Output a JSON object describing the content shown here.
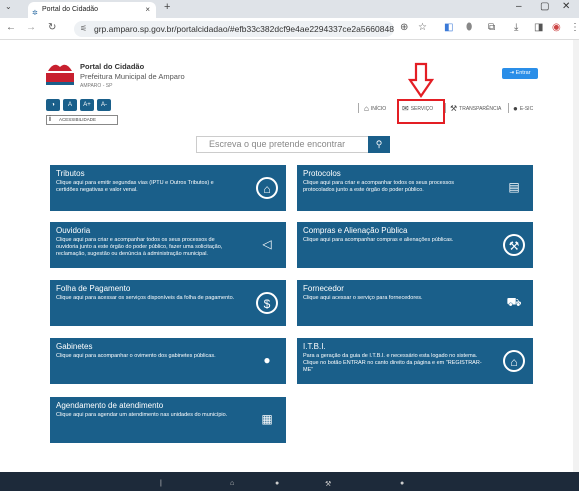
{
  "browser": {
    "tab_title": "Portal do Cidadão",
    "tab_close": "×",
    "new_tab": "+",
    "url": "grp.amparo.sp.gov.br/portalcidadao/#efb33c382dcf9e4ae2294337ce2a5660848a422c1230..."
  },
  "header": {
    "site_name": "Portal do Cidadão",
    "site_sub": "Prefeitura Municipal de Amparo",
    "site_city": "AMPARO - SP",
    "acc_buttons": [
      "◑",
      "A",
      "A+",
      "A-"
    ],
    "acc_label": "ACESSIBILIDADE",
    "acc_label_icon": "i",
    "login_label": "Entrar",
    "nav": {
      "inicio": "INÍCIO",
      "servico": "SERVIÇO",
      "transparencia": "TRANSPARÊNCIA",
      "esic": "E-SIC"
    }
  },
  "search": {
    "placeholder": "Escreva o que pretende encontrar"
  },
  "cards": [
    {
      "title": "Tributos",
      "desc": "Clique aqui para emitir segundas vias (IPTU e Outros Tributos) e certidões negativas e valor venal.",
      "icon": "bank-icon"
    },
    {
      "title": "Protocolos",
      "desc": "Clique aqui para criar e acompanhar todos os seus processos protocolados junto a este órgão do poder público.",
      "icon": "document-icon"
    },
    {
      "title": "Ouvidoria",
      "desc": "Clique aqui para criar e acompanhar todos os seus processos de ouvidoria junto a este órgão do poder público, fazer uma solicitação, reclamação, sugestão ou denúncia à administração municipal.",
      "icon": "megaphone-icon"
    },
    {
      "title": "Compras e Alienação Pública",
      "desc": "Clique aqui para acompanhar compras e alienações públicas.",
      "icon": "gavel-icon"
    },
    {
      "title": "Folha de Pagamento",
      "desc": "Clique aqui para acessar os serviços disponíveis da folha de pagamento.",
      "icon": "money-icon"
    },
    {
      "title": "Fornecedor",
      "desc": "Clique aqui acessar o serviço para fornecedores.",
      "icon": "cart-icon"
    },
    {
      "title": "Gabinetes",
      "desc": "Clique aqui para acompanhar o ovimento dos gabinetes públicas.",
      "icon": "person-icon"
    },
    {
      "title": "I.T.B.I.",
      "desc": "Para a geração da guia de I.T.B.I. e necessário esta logado no sistema. Clique no botão ENTRAR no canto direito da página e em \"REGISTRAR-ME\"",
      "icon": "house-icon"
    },
    {
      "title": "Agendamento de atendimento",
      "desc": "Clique aqui para agendar um atendimento nas unidades do município.",
      "icon": "calendar-icon"
    }
  ]
}
